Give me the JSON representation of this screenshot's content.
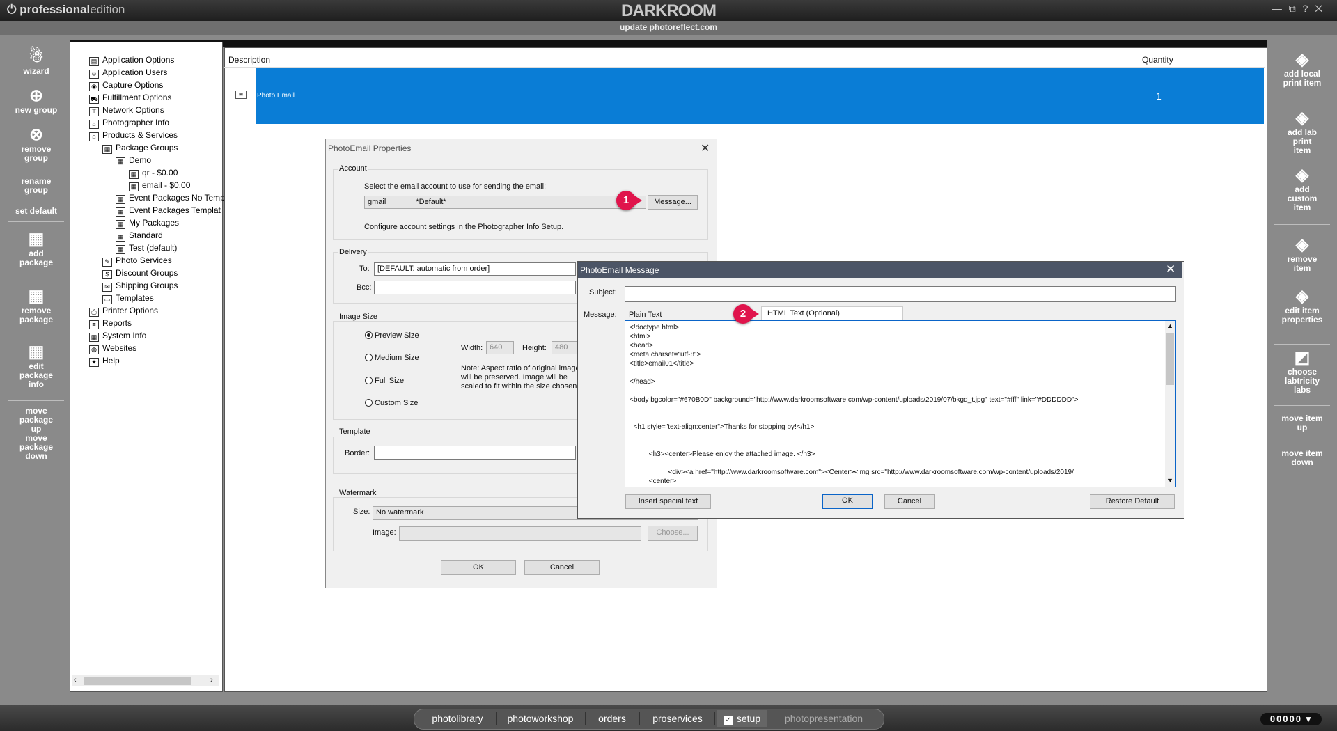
{
  "app": {
    "edition_bold": "professional",
    "edition_light": "edition",
    "brand": "DARKROOM",
    "window_controls": "— ⧉ ? ✕",
    "update_link": "update photoreflect.com"
  },
  "left_tools": [
    {
      "label": "wizard",
      "icon": "wizard-icon"
    },
    {
      "label": "new group",
      "icon": "plus-circle-icon"
    },
    {
      "label": "remove group",
      "icon": "x-circle-icon"
    },
    {
      "label": "rename group",
      "icon": ""
    },
    {
      "label": "set default",
      "icon": ""
    },
    {
      "label": "add package",
      "icon": "add-package-icon"
    },
    {
      "label": "remove package",
      "icon": "remove-package-icon"
    },
    {
      "label": "edit package info",
      "icon": "edit-package-icon"
    },
    {
      "label": "move package up",
      "icon": ""
    },
    {
      "label": "move package down",
      "icon": ""
    }
  ],
  "right_tools": [
    {
      "label": "add local print item",
      "icon": "add-local-print-icon"
    },
    {
      "label": "add lab print item",
      "icon": "add-lab-print-icon"
    },
    {
      "label": "add custom item",
      "icon": "add-custom-item-icon"
    },
    {
      "label": "remove item",
      "icon": "remove-item-icon"
    },
    {
      "label": "edit item properties",
      "icon": "edit-item-icon"
    },
    {
      "label": "choose labtricity labs",
      "icon": "labtricity-icon"
    },
    {
      "label": "move item up",
      "icon": ""
    },
    {
      "label": "move item down",
      "icon": ""
    }
  ],
  "tree": [
    {
      "label": "Application Options",
      "level": 0
    },
    {
      "label": "Application Users",
      "level": 0
    },
    {
      "label": "Capture Options",
      "level": 0
    },
    {
      "label": "Fulfillment Options",
      "level": 0
    },
    {
      "label": "Network Options",
      "level": 0
    },
    {
      "label": "Photographer Info",
      "level": 0
    },
    {
      "label": "Products & Services",
      "level": 0
    },
    {
      "label": "Package Groups",
      "level": 1
    },
    {
      "label": "Demo",
      "level": 2
    },
    {
      "label": "qr - $0.00",
      "level": 3
    },
    {
      "label": "email - $0.00",
      "level": 3
    },
    {
      "label": "Event Packages No Temp",
      "level": 2
    },
    {
      "label": "Event Packages Templat",
      "level": 2
    },
    {
      "label": "My Packages",
      "level": 2
    },
    {
      "label": "Standard",
      "level": 2
    },
    {
      "label": "Test (default)",
      "level": 2
    },
    {
      "label": "Photo Services",
      "level": 1
    },
    {
      "label": "Discount Groups",
      "level": 1
    },
    {
      "label": "Shipping Groups",
      "level": 1
    },
    {
      "label": "Templates",
      "level": 1
    },
    {
      "label": "Printer Options",
      "level": 0
    },
    {
      "label": "Reports",
      "level": 0
    },
    {
      "label": "System Info",
      "level": 0
    },
    {
      "label": "Websites",
      "level": 0
    },
    {
      "label": "Help",
      "level": 0
    }
  ],
  "table": {
    "columns": [
      "Description",
      "Quantity"
    ],
    "rows": [
      {
        "description": "Photo Email",
        "quantity": "1"
      }
    ]
  },
  "props_dialog": {
    "title": "PhotoEmail Properties",
    "account_group": "Account",
    "account_prompt": "Select the email account to use for sending the email:",
    "account_name": "gmail",
    "account_default": "*Default*",
    "message_button": "Message...",
    "account_note": "Configure account settings in the Photographer Info Setup.",
    "delivery_group": "Delivery",
    "to_label": "To:",
    "to_value": "[DEFAULT:  automatic from order]",
    "bcc_label": "Bcc:",
    "image_size_group": "Image Size",
    "sizes": [
      "Preview Size",
      "Medium Size",
      "Full Size",
      "Custom Size"
    ],
    "width_label": "Width:",
    "width_value": "640",
    "height_label": "Height:",
    "height_value": "480",
    "note_lines": [
      "Note: Aspect ratio of original image",
      "will be preserved. Image will be",
      "scaled to fit within the size chosen"
    ],
    "template_group": "Template",
    "border_label": "Border:",
    "watermark_group": "Watermark",
    "wm_size_label": "Size:",
    "wm_size_value": "No watermark",
    "wm_image_label": "Image:",
    "choose_button": "Choose...",
    "ok": "OK",
    "cancel": "Cancel"
  },
  "msg_dialog": {
    "title": "PhotoEmail Message",
    "subject_label": "Subject:",
    "message_label": "Message:",
    "tab_plain": "Plain Text",
    "tab_html": "HTML Text (Optional)",
    "code": "<!doctype html>\n<html>\n<head>\n<meta charset=\"utf-8\">\n<title>email01</title>\n\n</head>\n\n<body bgcolor=\"#670B0D\" background=\"http://www.darkroomsoftware.com/wp-content/uploads/2019/07/bkgd_t.jpg\" text=\"#fff\" link=\"#DDDDDD\">\n\n\n  <h1 style=\"text-align:center\">Thanks for stopping by!</h1>\n\n\n          <h3><center>Please enjoy the attached image. </h3>\n\n                    <div><a href=\"http://www.darkroomsoftware.com\"><Center><img src=\"http://www.darkroomsoftware.com/wp-content/uploads/2019/\n          <center>",
    "insert_button": "Insert special text",
    "ok": "OK",
    "cancel": "Cancel",
    "restore_button": "Restore Default"
  },
  "badges": [
    "1",
    "2"
  ],
  "bottom_tabs": [
    "photolibrary",
    "photoworkshop",
    "orders",
    "proservices",
    "setup",
    "photopresentation"
  ],
  "counter": "00000 ▾",
  "colors": {
    "selection": "#0a7dd6",
    "badge": "#e0144c",
    "msg_titlebar": "#4c5566"
  }
}
